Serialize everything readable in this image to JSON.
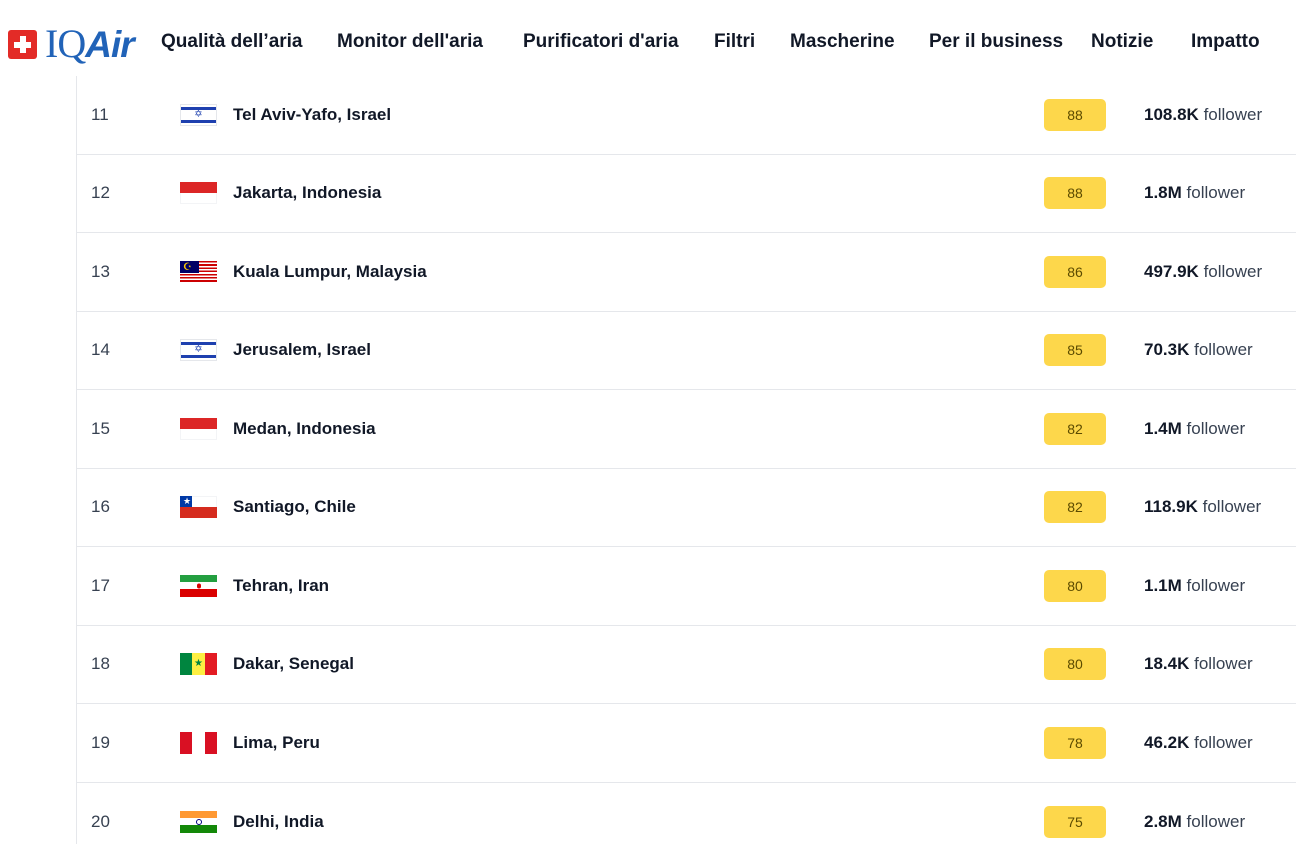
{
  "brand": {
    "iq": "IQ",
    "air": "Air"
  },
  "nav": [
    {
      "label": "Qualità dell’aria"
    },
    {
      "label": "Monitor dell'aria"
    },
    {
      "label": "Purificatori d'aria"
    },
    {
      "label": "Filtri"
    },
    {
      "label": "Mascherine"
    },
    {
      "label": "Per il business"
    },
    {
      "label": "Notizie"
    },
    {
      "label": "Impatto"
    }
  ],
  "follower_suffix": "follower",
  "rows": [
    {
      "rank": "11",
      "city": "Tel Aviv-Yafo, Israel",
      "aqi": "88",
      "followers": "108.8K",
      "flag": "israel-flag-icon"
    },
    {
      "rank": "12",
      "city": "Jakarta, Indonesia",
      "aqi": "88",
      "followers": "1.8M",
      "flag": "indonesia-flag-icon"
    },
    {
      "rank": "13",
      "city": "Kuala Lumpur, Malaysia",
      "aqi": "86",
      "followers": "497.9K",
      "flag": "malaysia-flag-icon"
    },
    {
      "rank": "14",
      "city": "Jerusalem, Israel",
      "aqi": "85",
      "followers": "70.3K",
      "flag": "israel-flag-icon"
    },
    {
      "rank": "15",
      "city": "Medan, Indonesia",
      "aqi": "82",
      "followers": "1.4M",
      "flag": "indonesia-flag-icon"
    },
    {
      "rank": "16",
      "city": "Santiago, Chile",
      "aqi": "82",
      "followers": "118.9K",
      "flag": "chile-flag-icon"
    },
    {
      "rank": "17",
      "city": "Tehran, Iran",
      "aqi": "80",
      "followers": "1.1M",
      "flag": "iran-flag-icon"
    },
    {
      "rank": "18",
      "city": "Dakar, Senegal",
      "aqi": "80",
      "followers": "18.4K",
      "flag": "senegal-flag-icon"
    },
    {
      "rank": "19",
      "city": "Lima, Peru",
      "aqi": "78",
      "followers": "46.2K",
      "flag": "peru-flag-icon"
    },
    {
      "rank": "20",
      "city": "Delhi, India",
      "aqi": "75",
      "followers": "2.8M",
      "flag": "india-flag-icon"
    }
  ],
  "colors": {
    "brand_blue": "#2163b8",
    "swiss_red": "#e32b27",
    "aqi_moderate": "#fdd74b"
  }
}
